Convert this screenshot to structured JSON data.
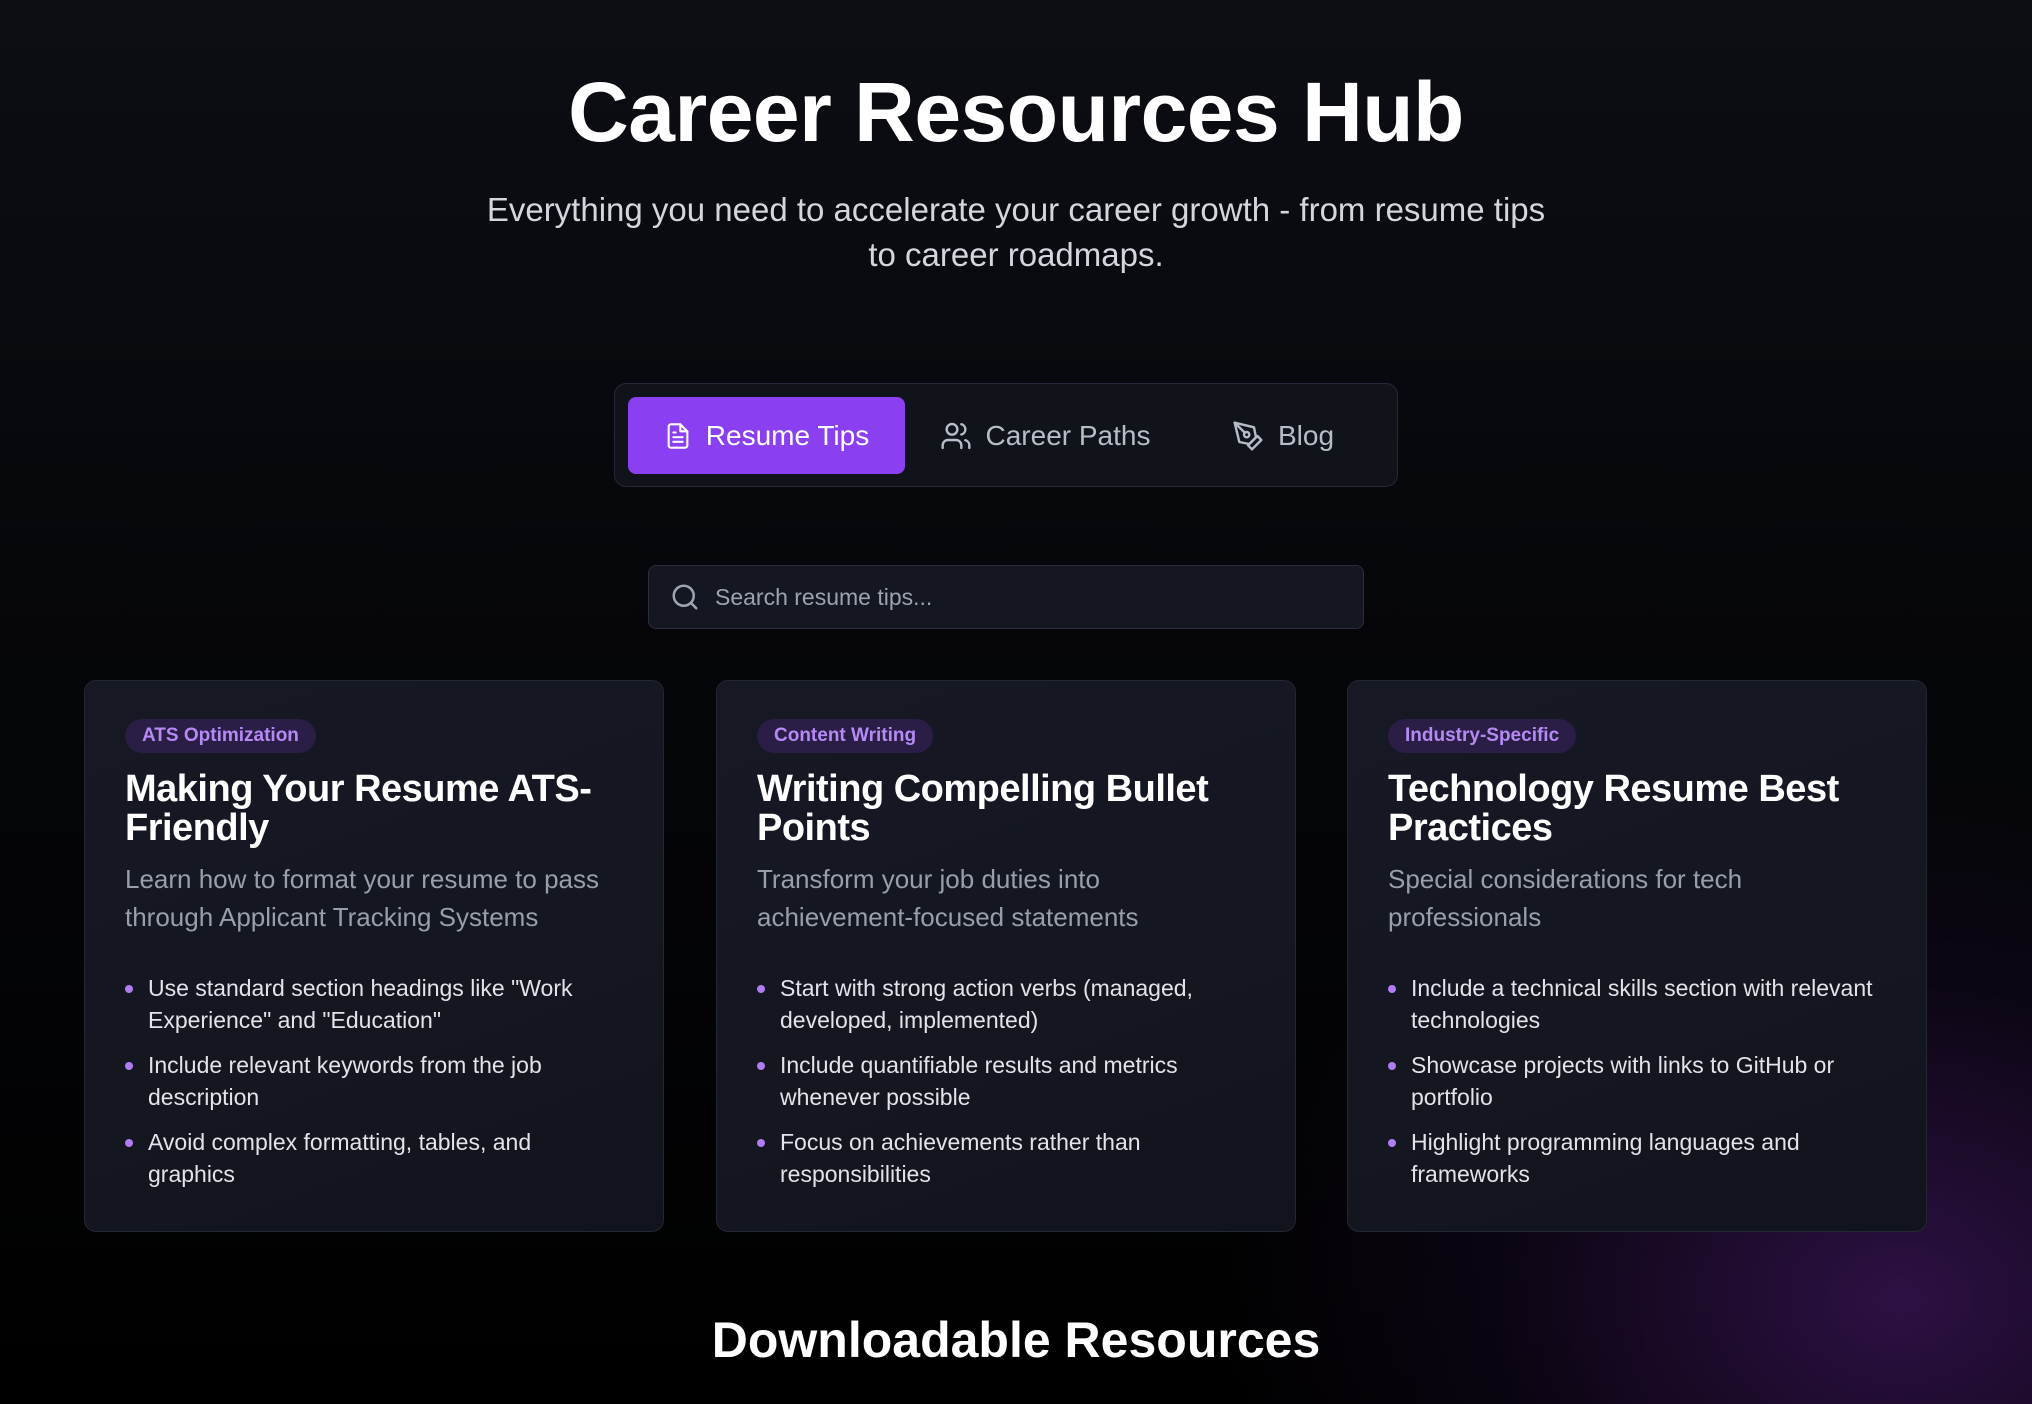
{
  "hero": {
    "title": "Career Resources Hub",
    "subtitle": "Everything you need to accelerate your career growth - from resume tips to career roadmaps."
  },
  "tabs": [
    {
      "label": "Resume Tips",
      "icon": "document-icon",
      "active": true
    },
    {
      "label": "Career Paths",
      "icon": "users-icon",
      "active": false
    },
    {
      "label": "Blog",
      "icon": "pen-tool-icon",
      "active": false
    }
  ],
  "search": {
    "placeholder": "Search resume tips...",
    "value": ""
  },
  "cards": [
    {
      "badge": "ATS Optimization",
      "title": "Making Your Resume ATS-Friendly",
      "description": "Learn how to format your resume to pass through Applicant Tracking Systems",
      "tips": [
        "Use standard section headings like \"Work Experience\" and \"Education\"",
        "Include relevant keywords from the job description",
        "Avoid complex formatting, tables, and graphics"
      ]
    },
    {
      "badge": "Content Writing",
      "title": "Writing Compelling Bullet Points",
      "description": "Transform your job duties into achievement-focused statements",
      "tips": [
        "Start with strong action verbs (managed, developed, implemented)",
        "Include quantifiable results and metrics whenever possible",
        "Focus on achievements rather than responsibilities"
      ]
    },
    {
      "badge": "Industry-Specific",
      "title": "Technology Resume Best Practices",
      "description": "Special considerations for tech professionals",
      "tips": [
        "Include a technical skills section with relevant technologies",
        "Showcase projects with links to GitHub or portfolio",
        "Highlight programming languages and frameworks"
      ]
    }
  ],
  "downloads": {
    "title": "Downloadable Resources"
  },
  "colors": {
    "accent": "#8a3ff0",
    "badge_text": "#b68af5",
    "badge_bg": "#2a1d46",
    "bullet": "#b07cf3"
  }
}
